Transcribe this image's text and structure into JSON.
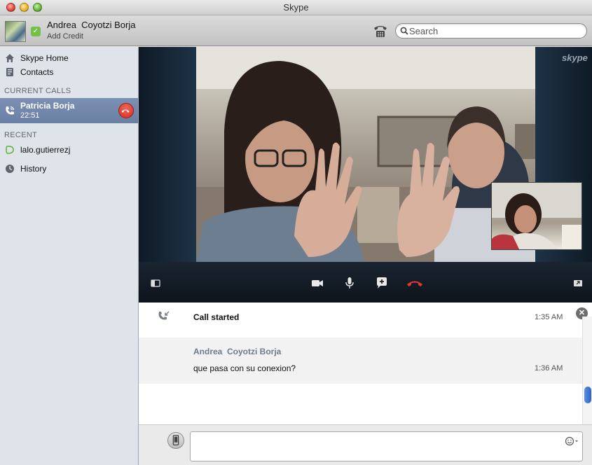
{
  "window": {
    "title": "Skype"
  },
  "toolbar": {
    "user_name": "Andrea  Coyotzi Borja",
    "credit_link": "Add Credit",
    "search_placeholder": "Search"
  },
  "sidebar": {
    "nav": [
      {
        "label": "Skype Home",
        "icon": "home-icon"
      },
      {
        "label": "Contacts",
        "icon": "contacts-icon"
      }
    ],
    "current_calls_label": "CURRENT CALLS",
    "current_call": {
      "name": "Patricia Borja",
      "duration": "22:51"
    },
    "recent_label": "RECENT",
    "recent": [
      {
        "label": "lalo.gutierrezj",
        "icon": "chat-bubble-icon"
      },
      {
        "label": "History",
        "icon": "clock-icon"
      }
    ]
  },
  "video": {
    "watermark": "skype"
  },
  "chat": {
    "call_event": {
      "text": "Call started",
      "time": "1:35 AM"
    },
    "message": {
      "author": "Andrea  Coyotzi Borja",
      "text": "que pasa con su conexion?",
      "time": "1:36 AM"
    }
  },
  "colors": {
    "accent_blue": "#6a7fa4",
    "hangup_red": "#d22b1e",
    "online_green": "#73c146"
  }
}
